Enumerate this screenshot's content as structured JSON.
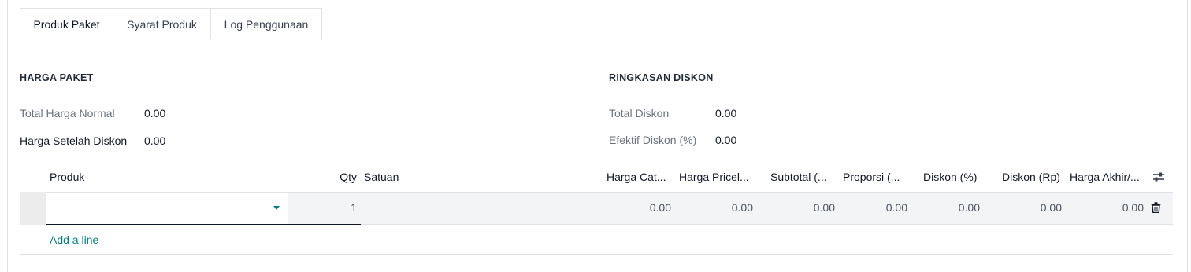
{
  "tabs": [
    {
      "label": "Produk Paket",
      "active": true
    },
    {
      "label": "Syarat Produk",
      "active": false
    },
    {
      "label": "Log Penggunaan",
      "active": false
    }
  ],
  "harga_paket": {
    "title": "HARGA PAKET",
    "total_normal_label": "Total Harga Normal",
    "total_normal_value": "0.00",
    "setelah_diskon_label": "Harga Setelah Diskon",
    "setelah_diskon_value": "0.00"
  },
  "ringkasan_diskon": {
    "title": "RINGKASAN DISKON",
    "total_diskon_label": "Total Diskon",
    "total_diskon_value": "0.00",
    "efektif_label": "Efektif Diskon (%)",
    "efektif_value": "0.00"
  },
  "table": {
    "headers": {
      "produk": "Produk",
      "qty": "Qty",
      "satuan": "Satuan",
      "harga_cat": "Harga Cat...",
      "harga_pricel": "Harga Pricel...",
      "subtotal": "Subtotal (...",
      "proporsi": "Proporsi (...",
      "diskon_pct": "Diskon (%)",
      "diskon_rp": "Diskon (Rp)",
      "harga_akhir": "Harga Akhir/..."
    },
    "row": {
      "produk": "",
      "qty": "1",
      "satuan": "",
      "harga_cat": "0.00",
      "harga_pricel": "0.00",
      "subtotal": "0.00",
      "proporsi": "0.00",
      "diskon_pct": "0.00",
      "diskon_rp": "0.00",
      "harga_akhir": "0.00"
    },
    "add_line": "Add a line"
  },
  "icons": {
    "settings": "sliders-icon",
    "trash": "trash-icon",
    "dropdown": "caret-down-icon"
  },
  "colors": {
    "link": "#017e84",
    "row_bg": "#f3f4f6"
  }
}
